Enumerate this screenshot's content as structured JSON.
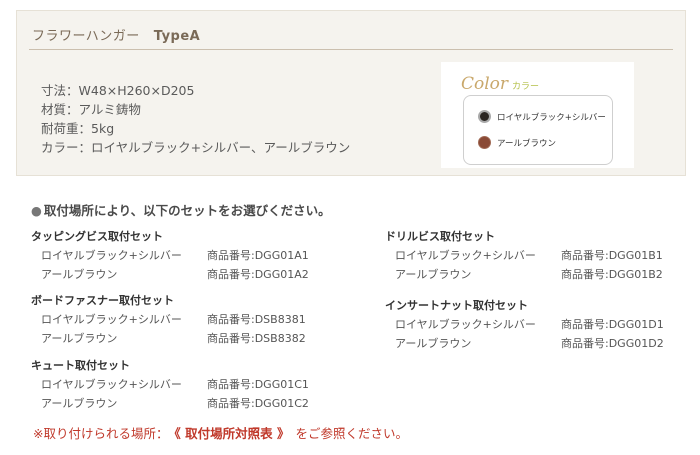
{
  "product": {
    "name": "フラワーハンガー",
    "type": "TypeA",
    "specs": [
      "寸法：W48×H260×D205",
      "材質：アルミ鋳物",
      "耐荷重：5kg",
      "カラー：ロイヤルブラック+シルバー、アールブラウン"
    ]
  },
  "color_box": {
    "title_en": "Color",
    "title_jp": "カラー",
    "swatches": [
      {
        "label": "ロイヤルブラック+シルバー",
        "color": "#2b2622"
      },
      {
        "label": "アールブラウン",
        "color": "#8a4a36"
      }
    ]
  },
  "sets_heading": "取付場所により、以下のセットをお選びください。",
  "sets": [
    {
      "title": "タッピングビス取付セット",
      "items": [
        {
          "color": "ロイヤルブラック+シルバー",
          "code": "商品番号:DGG01A1"
        },
        {
          "color": "アールブラウン",
          "code": "商品番号:DGG01A2"
        }
      ]
    },
    {
      "title": "ボードファスナー取付セット",
      "items": [
        {
          "color": "ロイヤルブラック+シルバー",
          "code": "商品番号:DSB8381"
        },
        {
          "color": "アールブラウン",
          "code": "商品番号:DSB8382"
        }
      ]
    },
    {
      "title": "キュート取付セット",
      "items": [
        {
          "color": "ロイヤルブラック+シルバー",
          "code": "商品番号:DGG01C1"
        },
        {
          "color": "アールブラウン",
          "code": "商品番号:DGG01C2"
        }
      ]
    },
    {
      "title": "ドリルビス取付セット",
      "items": [
        {
          "color": "ロイヤルブラック+シルバー",
          "code": "商品番号:DGG01B1"
        },
        {
          "color": "アールブラウン",
          "code": "商品番号:DGG01B2"
        }
      ]
    },
    {
      "title": "インサートナット取付セット",
      "items": [
        {
          "color": "ロイヤルブラック+シルバー",
          "code": "商品番号:DGG01D1"
        },
        {
          "color": "アールブラウン",
          "code": "商品番号:DGG01D2"
        }
      ]
    }
  ],
  "note": {
    "prefix": "※取り付けられる場所：",
    "link": "《 取付場所対照表 》",
    "suffix": "をご参照ください。"
  },
  "colors": {
    "accent_text": "#7a6a57",
    "warning": "#c0392b"
  }
}
